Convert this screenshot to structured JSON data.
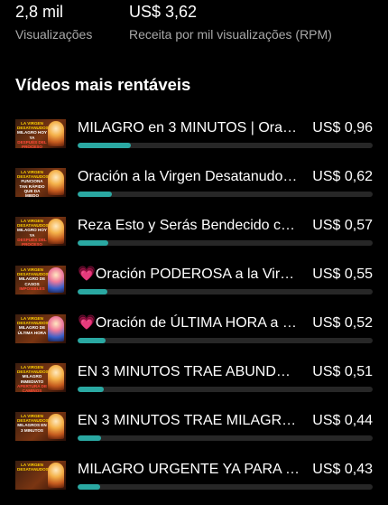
{
  "stats": {
    "views": {
      "value": "2,8 mil",
      "label": "Visualizações"
    },
    "rpm": {
      "value": "US$ 3,62",
      "label": "Receita por mil visualizações (RPM)"
    }
  },
  "section": {
    "title": "Vídeos mais rentáveis"
  },
  "colors": {
    "background": "#000000",
    "bar_track": "#272727",
    "bar_fill": "#2aa8a2",
    "secondary_text": "#a9a9a9"
  },
  "videos": [
    {
      "title": "MILAGRO en 3 MINUTOS | Oración...",
      "amount": "US$ 0,96",
      "revenue_fraction": 0.18,
      "thumb": {
        "top": "La Virgen Desatanudos",
        "mid": "Milagro hoy ya",
        "bot": "Después del Proceso Increíble"
      }
    },
    {
      "title": "Oración a la Virgen Desatanudos...",
      "amount": "US$ 0,62",
      "revenue_fraction": 0.115,
      "thumb": {
        "top": "La Virgen Desatanudos",
        "mid": "Funciona tan rápido que da miedo",
        "bot": ""
      }
    },
    {
      "title": "Reza Esto y Serás Bendecido con...",
      "amount": "US$ 0,57",
      "revenue_fraction": 0.105,
      "thumb": {
        "top": "La Virgen Desatanudos",
        "mid": "Milagro hoy ya",
        "bot": "Después del Proceso Increíble"
      }
    },
    {
      "title": "💗Oración PODEROSA a la Virgen...",
      "amount": "US$ 0,55",
      "revenue_fraction": 0.1,
      "thumb": {
        "top": "La Virgen Desatanudos",
        "mid": "Milagro de Casos",
        "bot": "Imposibles"
      }
    },
    {
      "title": "💗Oración de ÚLTIMA HORA a la...",
      "amount": "US$ 0,52",
      "revenue_fraction": 0.095,
      "thumb": {
        "top": "La Virgen Desatanudos",
        "mid": "Milagro de Última Hora",
        "bot": ""
      }
    },
    {
      "title": "EN 3 MINUTOS TRAE ABUNDANCIA...",
      "amount": "US$ 0,51",
      "revenue_fraction": 0.09,
      "thumb": {
        "top": "La Virgen Desatanudos",
        "mid": "Milagro Inmediato",
        "bot": "Apertura de Caminos"
      }
    },
    {
      "title": "EN 3 MINUTOS TRAE MILAGROS...",
      "amount": "US$ 0,44",
      "revenue_fraction": 0.08,
      "thumb": {
        "top": "La Virgen Desatanudos",
        "mid": "Milagros en 3 minutos",
        "bot": ""
      }
    },
    {
      "title": "MILAGRO URGENTE YA PARA TI...",
      "amount": "US$ 0,43",
      "revenue_fraction": 0.075,
      "thumb": {
        "top": "La Virgen Desatanudos",
        "mid": "",
        "bot": ""
      }
    }
  ]
}
